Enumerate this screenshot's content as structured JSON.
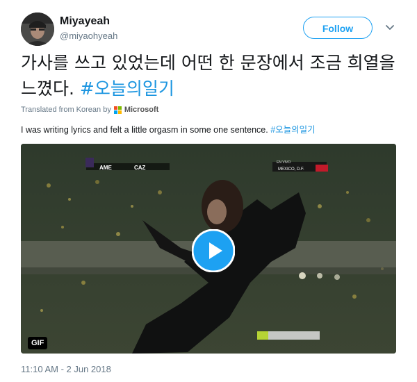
{
  "author": {
    "name": "Miyayeah",
    "handle": "@miyaohyeah",
    "follow_label": "Follow"
  },
  "tweet": {
    "text": "가사를 쓰고 있었는데 어떤 한 문장에서 조금 희열을 느꼈다. ",
    "hashtag": "#오늘의일기",
    "translated_from": "Translated from Korean by",
    "translator": "Microsoft",
    "translation_text": "I was writing lyrics and felt a little orgasm in some one sentence. ",
    "translation_hashtag": "#오늘의일기",
    "timestamp": "11:10 AM - 2 Jun 2018"
  },
  "media": {
    "badge": "GIF",
    "scoreboard_left": "AME",
    "scoreboard_right": "CAZ",
    "broadcast_tag": "EN VIVO",
    "broadcast_location": "MEXICO, D.F."
  },
  "colors": {
    "accent": "#1da1f2",
    "hashtag": "#1b95e0",
    "secondary_text": "#657786"
  },
  "icons": {
    "menu": "chevron-down-icon",
    "play": "play-icon",
    "translator_logo": "microsoft-logo-icon"
  }
}
